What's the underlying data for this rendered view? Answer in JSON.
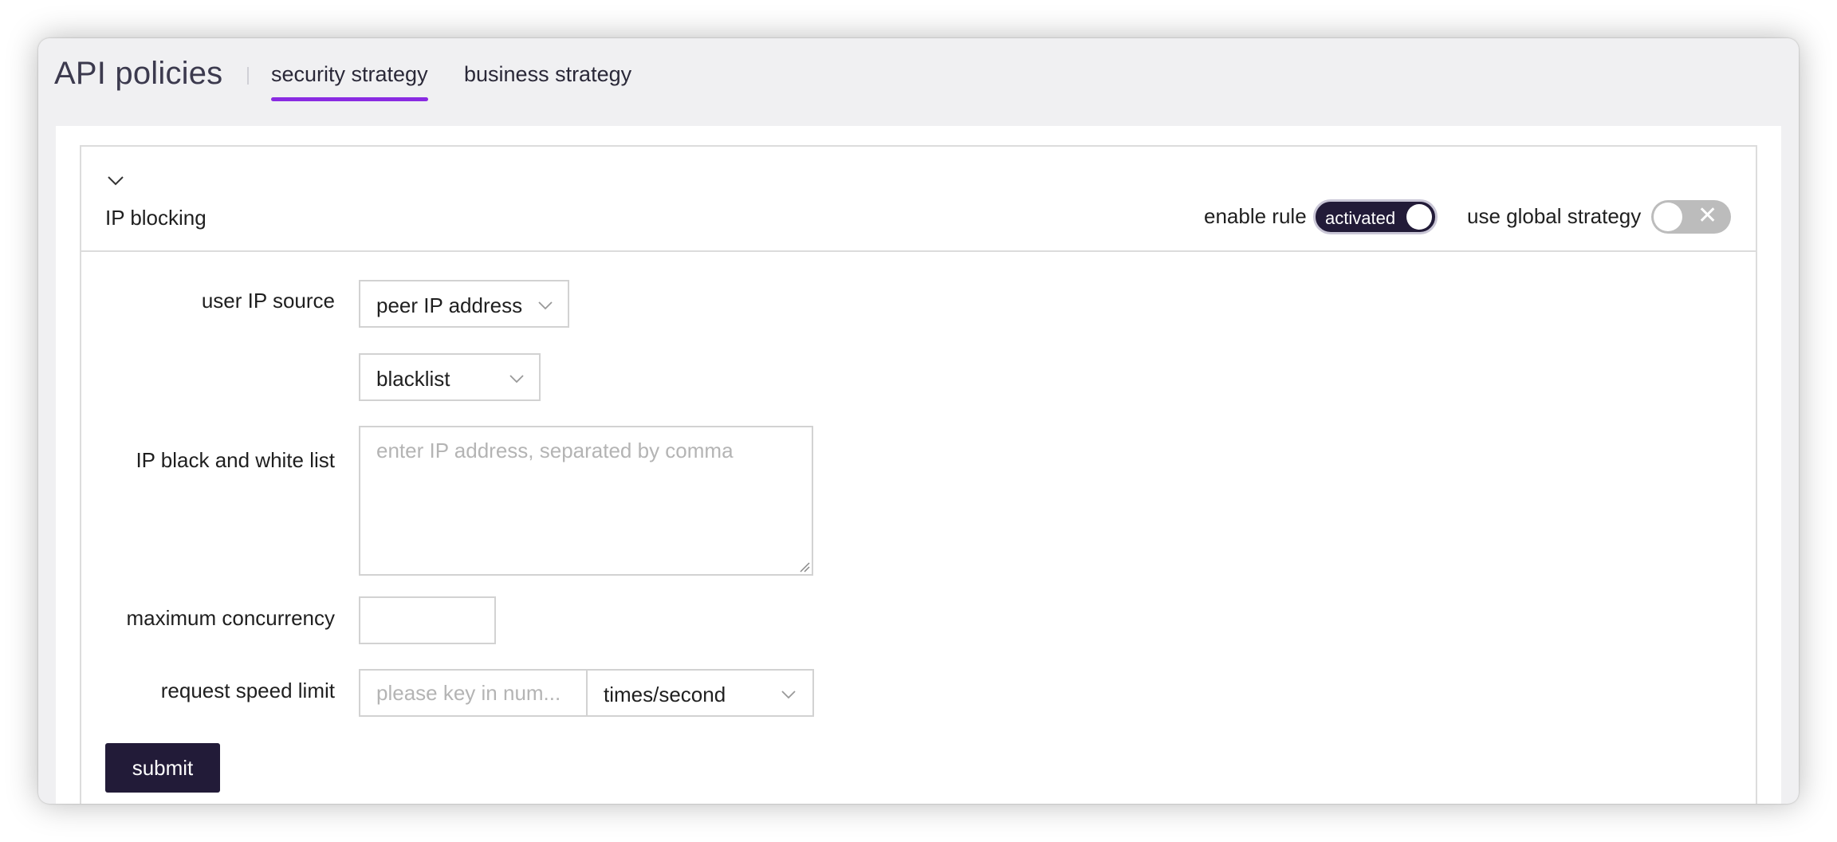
{
  "header": {
    "title": "API policies",
    "tabs": [
      {
        "label": "security strategy",
        "active": true
      },
      {
        "label": "business strategy",
        "active": false
      }
    ],
    "accent_color": "#8a2be2"
  },
  "section": {
    "title": "IP blocking",
    "collapse_icon": "chevron-down-icon",
    "enable_rule": {
      "label": "enable rule",
      "toggle_text": "activated",
      "on": true
    },
    "global_strategy": {
      "label": "use global strategy",
      "toggle_text": "✕",
      "on": false
    }
  },
  "form": {
    "ip_source": {
      "label": "user IP source",
      "value": "peer IP address"
    },
    "list_type": {
      "value": "blacklist"
    },
    "ip_list": {
      "label": "IP black and white list",
      "placeholder": "enter IP address, separated by comma",
      "value": ""
    },
    "max_concurrency": {
      "label": "maximum concurrency",
      "value": ""
    },
    "speed_limit": {
      "label": "request speed limit",
      "placeholder": "please key in num...",
      "unit": "times/second"
    },
    "submit_label": "submit"
  },
  "colors": {
    "primary_dark": "#221b38"
  }
}
